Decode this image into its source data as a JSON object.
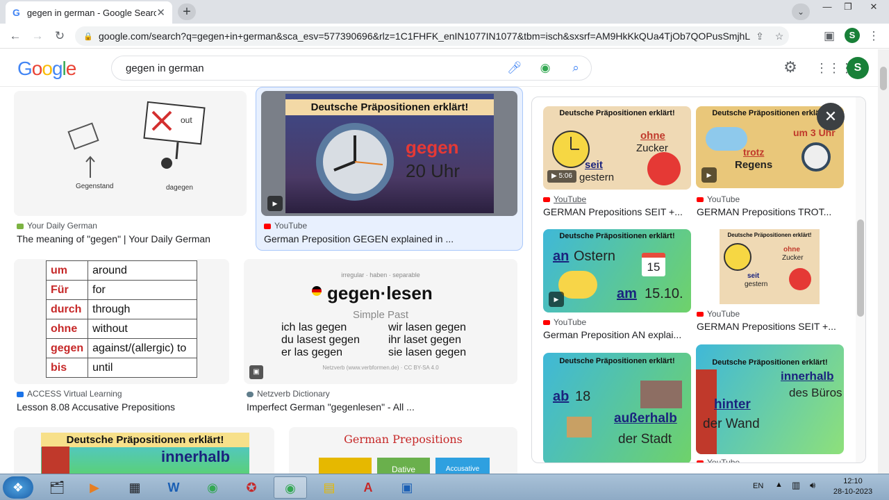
{
  "browser": {
    "tab_title": "gegen in german - Google Search",
    "tab_favicon": "G",
    "url": "google.com/search?q=gegen+in+german&sca_esv=577390696&rlz=1C1FHFK_enIN1077IN1077&tbm=isch&sxsrf=AM9HkKkQUa4TjOb7QOPusSmjhLosC...",
    "profile_initial": "S"
  },
  "google": {
    "logo": "Google",
    "query": "gegen in german",
    "avatar_initial": "S"
  },
  "results": [
    {
      "source": "Your Daily German",
      "caption": "The meaning of \"gegen\" | Your Daily German",
      "img_labels": [
        "Gegenstand",
        "dagegen",
        "out"
      ]
    },
    {
      "source": "YouTube",
      "caption": "German Preposition GEGEN explained in ...",
      "img_title": "Deutsche Präpositionen erklärt!",
      "img_word": "gegen",
      "img_sub": "20 Uhr"
    },
    {
      "source": "ACCESS Virtual Learning",
      "caption": "Lesson 8.08 Accusative Prepositions",
      "table": [
        [
          "um",
          "around"
        ],
        [
          "Für",
          "for"
        ],
        [
          "durch",
          "through"
        ],
        [
          "ohne",
          "without"
        ],
        [
          "gegen",
          "against/(allergic) to"
        ],
        [
          "bis",
          "until"
        ]
      ]
    },
    {
      "source": "Netzverb Dictionary",
      "caption": "Imperfect German \"gegenlesen\" - All ...",
      "img_top": "irregular · haben · separable",
      "img_title": "gegen·lesen",
      "img_sub": "Simple Past",
      "img_lines": [
        "ich las gegen",
        "wir lasen gegen",
        "du lasest gegen",
        "ihr laset gegen",
        "er las gegen",
        "sie lasen gegen"
      ],
      "img_foot": "Netzverb (www.verbformen.de) · CC BY-SA 4.0"
    },
    {
      "img_title": "Deutsche Präpositionen erklärt!",
      "img_word": "innerhalb"
    },
    {
      "img_title": "German Prepositions",
      "img_words": [
        "Dative",
        "Accusative"
      ]
    }
  ],
  "panel": {
    "items": [
      {
        "source": "YouTube",
        "caption": "GERMAN Prepositions SEIT +...",
        "img_title": "Deutsche Präpositionen erklärt!",
        "words": [
          "ohne",
          "Zucker",
          "seit",
          "gestern"
        ],
        "duration": "5:06"
      },
      {
        "source": "YouTube",
        "caption": "GERMAN Prepositions TROT...",
        "img_title": "Deutsche Präpositionen erklärt!",
        "words": [
          "um 3 Uhr",
          "trotz",
          "Regens"
        ]
      },
      {
        "source": "YouTube",
        "caption": "German Preposition AN explai...",
        "img_title": "Deutsche Präpositionen erklärt!",
        "words": [
          "an",
          "Ostern",
          "15",
          "am",
          "15.10."
        ]
      },
      {
        "source": "YouTube",
        "caption": "GERMAN Prepositions SEIT +...",
        "img_title": "Deutsche Präpositionen erklärt!",
        "words": [
          "ohne",
          "Zucker",
          "seit",
          "gestern"
        ]
      },
      {
        "source": "",
        "caption": "",
        "img_title": "Deutsche Präpositionen erklärt!",
        "words": [
          "ab",
          "18",
          "außerhalb",
          "der Stadt"
        ]
      },
      {
        "source": "YouTube",
        "caption": "",
        "img_title": "Deutsche Präpositionen erklärt!",
        "words": [
          "innerhalb",
          "des Büros",
          "hinter",
          "der Wand"
        ]
      }
    ]
  },
  "taskbar": {
    "lang": "EN",
    "time": "12:10",
    "date": "28-10-2023"
  }
}
